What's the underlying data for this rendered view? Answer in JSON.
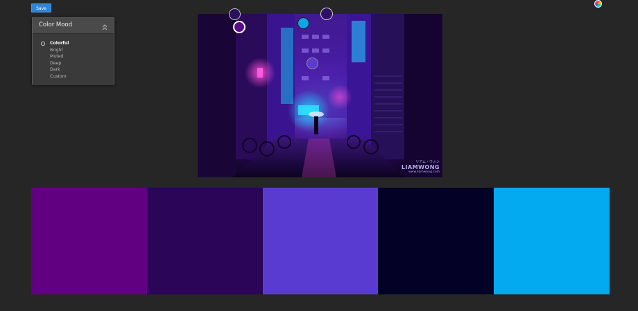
{
  "toolbar": {
    "save_label": "Save"
  },
  "icons": {
    "color_wheel": "color-wheel-icon",
    "collapse": "chevron-double-up-icon",
    "radio": "radio-icon"
  },
  "mood_panel": {
    "title": "Color Mood",
    "selected": "Colorful",
    "options": [
      "Colorful",
      "Bright",
      "Muted",
      "Deep",
      "Dark",
      "Custom"
    ]
  },
  "photo": {
    "watermark_jp": "リアム・ウォン",
    "watermark_name": "LIAMWONG",
    "watermark_url": "www.liamwong.com"
  },
  "pickers": [
    {
      "color": "#2a0f5a"
    },
    {
      "color": "#5a0d8a"
    },
    {
      "color": "#0aa6e6"
    },
    {
      "color": "#2e0e66"
    },
    {
      "color": "#5a3cd0"
    }
  ],
  "palette": {
    "swatches": [
      "#620082",
      "#2a0558",
      "#5a3bd2",
      "#030226",
      "#04aaf0"
    ]
  }
}
